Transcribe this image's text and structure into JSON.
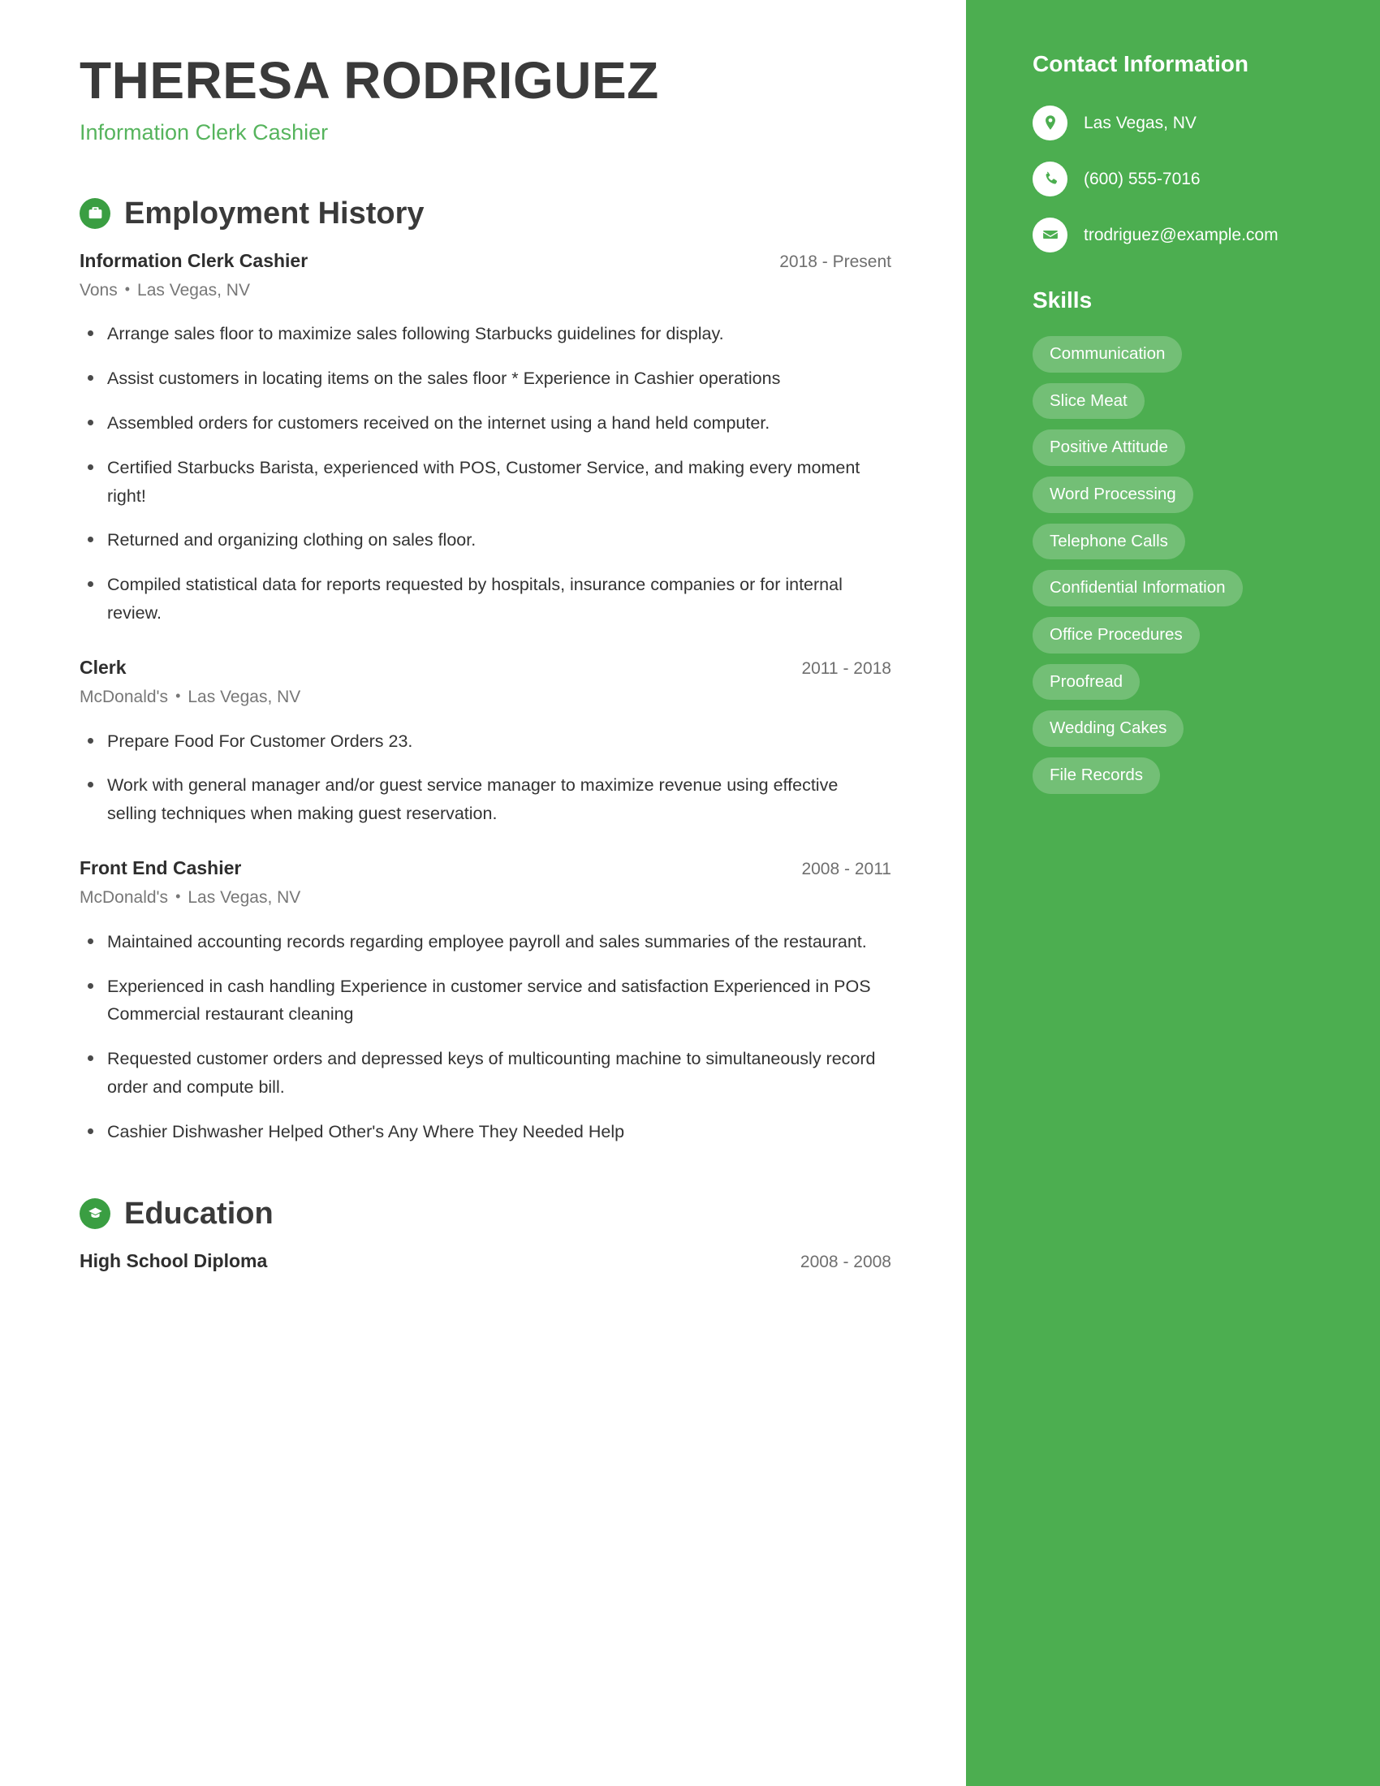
{
  "header": {
    "full_name": "THERESA RODRIGUEZ",
    "job_title": "Information Clerk Cashier"
  },
  "employment": {
    "section_title": "Employment History",
    "icon": "briefcase-icon",
    "entries": [
      {
        "title": "Information Clerk Cashier",
        "date": "2018 - Present",
        "company": "Vons",
        "separator": "•",
        "location": "Las Vegas, NV",
        "bullets": [
          "Arrange sales floor to maximize sales following Starbucks guidelines for display.",
          "Assist customers in locating items on the sales floor * Experience in Cashier operations",
          "Assembled orders for customers received on the internet using a hand held computer.",
          "Certified Starbucks Barista, experienced with POS, Customer Service, and making every moment right!",
          "Returned and organizing clothing on sales floor.",
          "Compiled statistical data for reports requested by hospitals, insurance companies or for internal review."
        ]
      },
      {
        "title": "Clerk",
        "date": "2011 - 2018",
        "company": "McDonald's",
        "separator": "•",
        "location": "Las Vegas, NV",
        "bullets": [
          "Prepare Food For Customer Orders 23.",
          "Work with general manager and/or guest service manager to maximize revenue using effective selling techniques when making guest reservation."
        ]
      },
      {
        "title": "Front End Cashier",
        "date": "2008 - 2011",
        "company": "McDonald's",
        "separator": "•",
        "location": "Las Vegas, NV",
        "bullets": [
          "Maintained accounting records regarding employee payroll and sales summaries of the restaurant.",
          "Experienced in cash handling Experience in customer service and satisfaction Experienced in POS Commercial restaurant cleaning",
          "Requested customer orders and depressed keys of multicounting machine to simultaneously record order and compute bill.",
          "Cashier Dishwasher Helped Other's Any Where They Needed Help"
        ]
      }
    ]
  },
  "education": {
    "section_title": "Education",
    "icon": "graduation-cap-icon",
    "entries": [
      {
        "title": "High School Diploma",
        "date": "2008 - 2008"
      }
    ]
  },
  "sidebar": {
    "contact": {
      "title": "Contact Information",
      "items": [
        {
          "icon": "location-pin-icon",
          "value": "Las Vegas, NV"
        },
        {
          "icon": "phone-icon",
          "value": "(600) 555-7016"
        },
        {
          "icon": "envelope-icon",
          "value": "trodriguez@example.com"
        }
      ]
    },
    "skills": {
      "title": "Skills",
      "items": [
        "Communication",
        "Slice Meat",
        "Positive Attitude",
        "Word Processing",
        "Telephone Calls",
        "Confidential Information",
        "Office Procedures",
        "Proofread",
        "Wedding Cakes",
        "File Records"
      ]
    }
  },
  "colors": {
    "sidebar_green": "#4cae50",
    "accent_green": "#56b45d",
    "icon_green": "#3a9e42",
    "heading_dark": "#3a3a3a",
    "body_text": "#333333",
    "muted_text": "#777777"
  }
}
